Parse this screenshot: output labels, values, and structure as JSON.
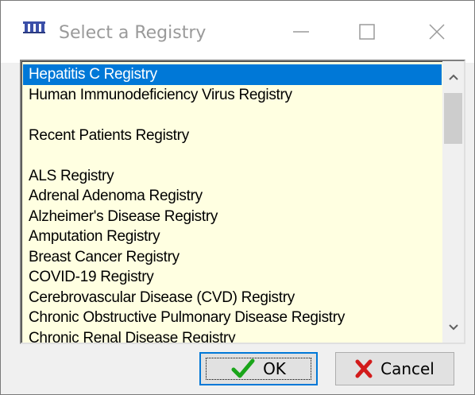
{
  "window": {
    "title": "Select a Registry"
  },
  "registry_list": {
    "items": [
      {
        "label": "Hepatitis C Registry",
        "selected": true
      },
      {
        "label": "Human Immunodeficiency Virus Registry"
      },
      {
        "label": ""
      },
      {
        "label": "Recent Patients Registry"
      },
      {
        "label": ""
      },
      {
        "label": "ALS Registry"
      },
      {
        "label": "Adrenal Adenoma Registry"
      },
      {
        "label": "Alzheimer's Disease Registry"
      },
      {
        "label": "Amputation Registry"
      },
      {
        "label": "Breast Cancer Registry"
      },
      {
        "label": "COVID-19 Registry"
      },
      {
        "label": "Cerebrovascular Disease (CVD) Registry"
      },
      {
        "label": "Chronic Obstructive Pulmonary Disease Registry"
      },
      {
        "label": "Chronic Renal Disease Registry"
      }
    ]
  },
  "buttons": {
    "ok_label": "OK",
    "cancel_label": "Cancel"
  },
  "colors": {
    "selection": "#0078d7",
    "list_background": "#ffffe1",
    "ok_check": "#1aa51a",
    "cancel_x": "#d21b1b"
  },
  "icons": {
    "app": "registry-app-icon",
    "ok": "checkmark-icon",
    "cancel": "red-x-icon"
  }
}
